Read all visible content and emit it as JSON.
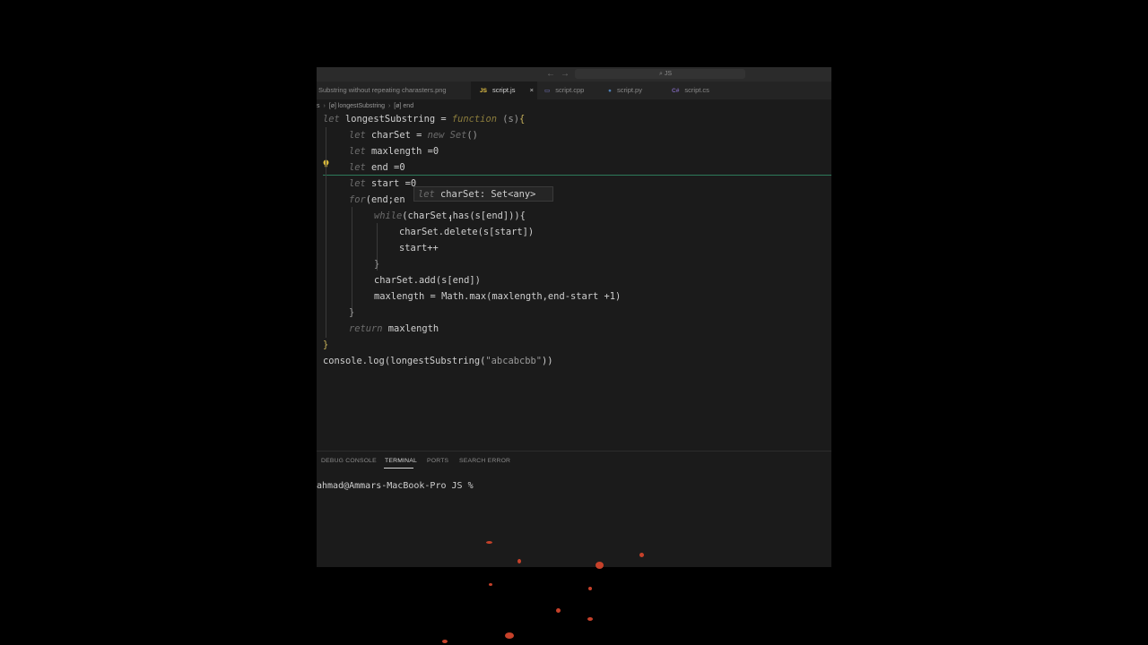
{
  "titlebar": {
    "search_text": "JS"
  },
  "tabs": [
    {
      "label": "Substring without repeating charasters.png",
      "icon": "",
      "active": false
    },
    {
      "label": "script.js",
      "icon": "JS",
      "active": true,
      "close": "×"
    },
    {
      "label": "script.cpp",
      "icon": "",
      "active": false
    },
    {
      "label": "script.py",
      "icon": "",
      "active": false
    },
    {
      "label": "script.cs",
      "icon": "C#",
      "active": false
    }
  ],
  "breadcrumb": {
    "file": "s",
    "symbol_1": "longestSubstring",
    "symbol_2": "end",
    "symbol_icon": "[ø]"
  },
  "code": {
    "l1_kw": "let",
    "l1_a": " longestSubstring = ",
    "l1_fn": "function",
    "l1_b": " (s)",
    "l1_brace": "{",
    "l2_kw": "let",
    "l2_a": " charSet = ",
    "l2_new": "new Set",
    "l2_b": "()",
    "l3_kw": "let",
    "l3_a": " maxlength =0",
    "l4_kw": "let",
    "l4_a": " end =0",
    "l5_kw": "let",
    "l5_a": " start =0",
    "l6_kw": "for",
    "l6_a": "(end;en",
    "l7_kw": "while",
    "l7_a": "(charSet.has(s[end])){",
    "l8_a": "charSet.delete(s[start])",
    "l9_a": "start++",
    "l10_a": "}",
    "l11_a": "charSet.add(s[end])",
    "l12_a": "maxlength = Math.max(maxlength,end-start +1)",
    "l13_a": "}",
    "l14_kw": "return",
    "l14_a": " maxlength",
    "l15_a": "}",
    "l16_a": "console.log(longestSubstring(",
    "l16_str": "\"abcabcbb\"",
    "l16_b": "))"
  },
  "hover": {
    "kw": "let",
    "name": " charSet: ",
    "type": "Set<any>"
  },
  "panel": {
    "tabs": [
      "DEBUG CONSOLE",
      "TERMINAL",
      "PORTS",
      "SEARCH ERROR"
    ],
    "active_tab": "TERMINAL",
    "prompt": "ahmad@Ammars-MacBook-Pro JS %"
  },
  "colors": {
    "background": "#000000",
    "editor": "#1b1b1b",
    "accent_line": "#2d7a5a",
    "js_icon": "#e8c547",
    "py_icon": "#4f7fb5",
    "cs_icon": "#7a63b0"
  }
}
